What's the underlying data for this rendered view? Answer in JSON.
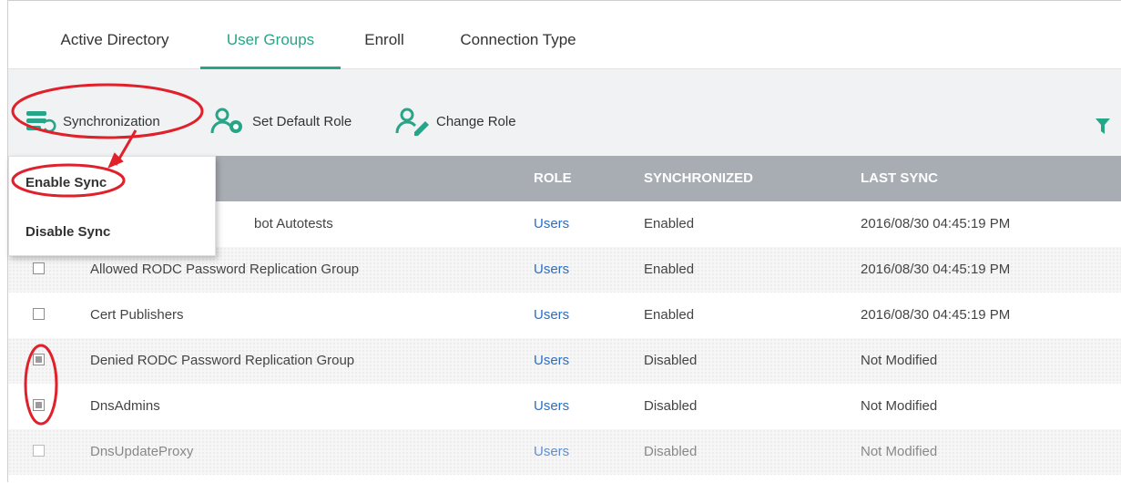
{
  "tabs": [
    {
      "label": "Active Directory",
      "active": false
    },
    {
      "label": "User Groups",
      "active": true
    },
    {
      "label": "Enroll",
      "active": false
    },
    {
      "label": "Connection Type",
      "active": false
    }
  ],
  "toolbar": {
    "sync_label": "Synchronization",
    "default_role_label": "Set Default Role",
    "change_role_label": "Change Role"
  },
  "dropdown": {
    "items": [
      "Enable Sync",
      "Disable Sync"
    ]
  },
  "table": {
    "columns": [
      "ROLE",
      "SYNCHRONIZED",
      "LAST SYNC"
    ],
    "rows": [
      {
        "name": "bot Autotests",
        "role": "Users",
        "sync": "Enabled",
        "last_sync": "2016/08/30 04:45:19 PM",
        "checked": false
      },
      {
        "name": "Allowed RODC Password Replication Group",
        "role": "Users",
        "sync": "Enabled",
        "last_sync": "2016/08/30 04:45:19 PM",
        "checked": false
      },
      {
        "name": "Cert Publishers",
        "role": "Users",
        "sync": "Enabled",
        "last_sync": "2016/08/30 04:45:19 PM",
        "checked": false
      },
      {
        "name": "Denied RODC Password Replication Group",
        "role": "Users",
        "sync": "Disabled",
        "last_sync": "Not Modified",
        "checked": true
      },
      {
        "name": "DnsAdmins",
        "role": "Users",
        "sync": "Disabled",
        "last_sync": "Not Modified",
        "checked": true
      },
      {
        "name": "DnsUpdateProxy",
        "role": "Users",
        "sync": "Disabled",
        "last_sync": "Not Modified",
        "checked": false
      }
    ]
  },
  "colors": {
    "accent": "#27a589",
    "header_bg": "#a8adb3",
    "link": "#2a6fc4",
    "annotation": "#e0202a"
  },
  "icons": [
    "sync-stack-icon",
    "user-default-role-icon",
    "user-edit-icon",
    "filter-icon"
  ]
}
